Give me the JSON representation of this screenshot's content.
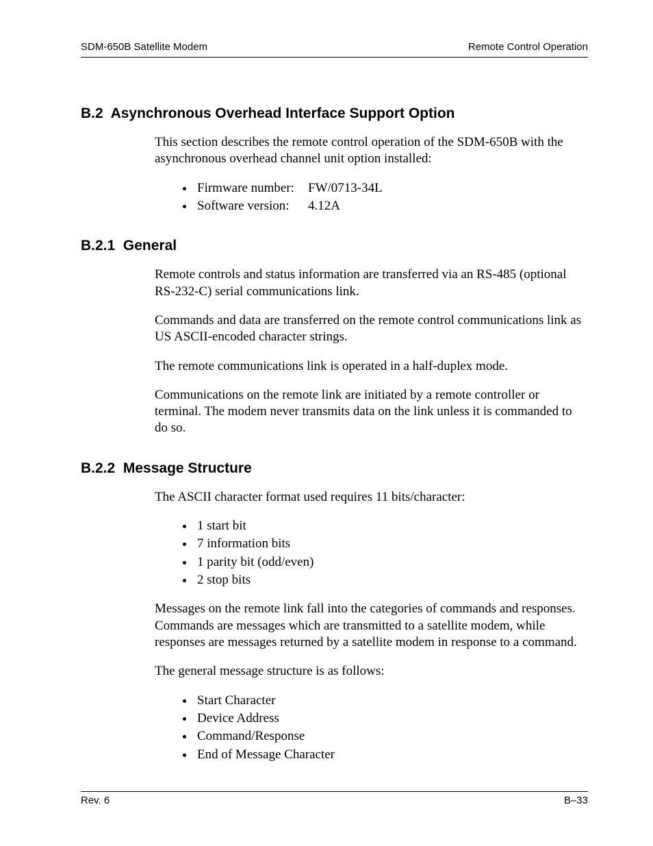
{
  "header": {
    "left": "SDM-650B Satellite Modem",
    "right": "Remote Control Operation"
  },
  "section_b2": {
    "number": "B.2",
    "title": "Asynchronous Overhead Interface Support Option",
    "intro": "This section describes the remote control operation of the SDM-650B with the asynchronous overhead channel unit option installed:",
    "bullets": [
      {
        "label": "Firmware number:",
        "value": "FW/0713-34L"
      },
      {
        "label": "Software version:",
        "value": "4.12A"
      }
    ]
  },
  "section_b21": {
    "number": "B.2.1",
    "title": "General",
    "paras": [
      "Remote controls and status information are transferred via an RS-485 (optional RS-232-C) serial communications link.",
      "Commands and data are transferred on the remote control communications link as US ASCII-encoded character strings.",
      "The remote communications link is operated in a half-duplex mode.",
      "Communications on the remote link are initiated by a remote controller or terminal. The modem never transmits data on the link unless it is commanded to do so."
    ]
  },
  "section_b22": {
    "number": "B.2.2",
    "title": "Message Structure",
    "intro": "The ASCII character format used requires 11 bits/character:",
    "char_bits": [
      "1 start bit",
      "7 information bits",
      "1 parity bit (odd/even)",
      "2 stop bits"
    ],
    "para2": "Messages on the remote link fall into the categories of commands and responses. Commands are messages which are transmitted to a satellite modem, while responses are messages returned by a satellite modem in response to a command.",
    "para3": "The general message structure is as follows:",
    "msg_struct": [
      "Start Character",
      "Device Address",
      "Command/Response",
      "End of Message Character"
    ]
  },
  "footer": {
    "left": "Rev. 6",
    "right": "B–33"
  }
}
